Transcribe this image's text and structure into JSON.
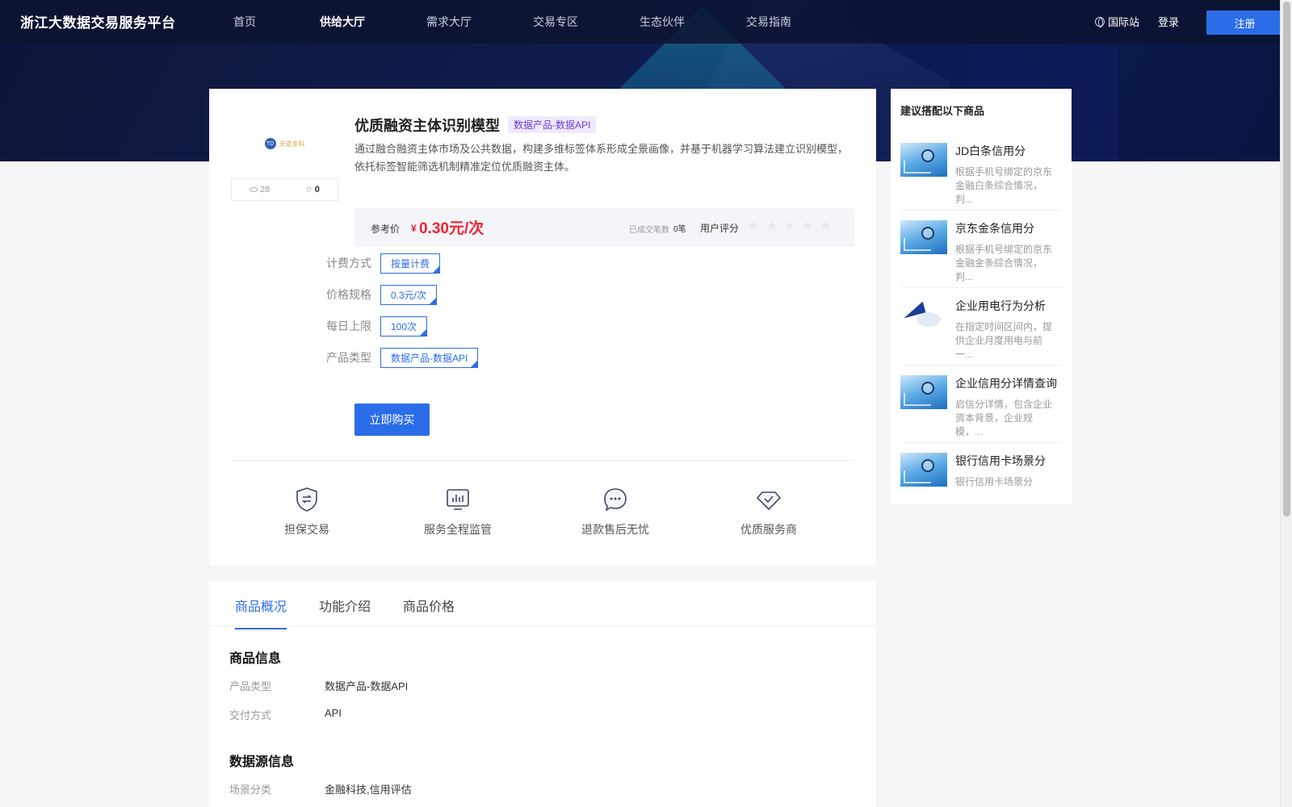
{
  "header": {
    "logo": "浙江大数据交易服务平台",
    "nav": [
      "首页",
      "供给大厅",
      "需求大厅",
      "交易专区",
      "生态伙伴",
      "交易指南"
    ],
    "active_nav": 1,
    "intl": "国际站",
    "login": "登录",
    "register": "注册"
  },
  "product": {
    "logo_brand": "天道金科",
    "logo_mark": "TD",
    "views": "28",
    "stars": "0",
    "title": "优质融资主体识别模型",
    "type_badge": "数据产品-数据API",
    "description": "通过融合融资主体市场及公共数据，构建多维标签体系形成全景画像，并基于机器学习算法建立识别模型，依托标签智能筛选机制精准定位优质融资主体。",
    "price_label": "参考价",
    "currency": "¥",
    "price": "0.30元/次",
    "deals_label": "已成交笔数",
    "deals_value": "0笔",
    "rating_label": "用户评分",
    "rating_stars": "★★★★★",
    "rating": 0,
    "specs": [
      {
        "label": "计费方式",
        "value": "按量计费"
      },
      {
        "label": "价格规格",
        "value": "0.3元/次"
      },
      {
        "label": "每日上限",
        "value": "100次"
      },
      {
        "label": "产品类型",
        "value": "数据产品-数据API"
      }
    ],
    "buy_button": "立即购买",
    "guarantees": [
      {
        "icon": "shield-exchange-icon",
        "text": "担保交易"
      },
      {
        "icon": "monitor-chart-icon",
        "text": "服务全程监管"
      },
      {
        "icon": "chat-bubble-icon",
        "text": "退款售后无忧"
      },
      {
        "icon": "diamond-check-icon",
        "text": "优质服务商"
      }
    ]
  },
  "tabs": {
    "items": [
      "商品概况",
      "功能介绍",
      "商品价格"
    ],
    "active": 0
  },
  "details": {
    "product_info_title": "商品信息",
    "product_info": [
      {
        "k": "产品类型",
        "v": "数据产品-数据API"
      },
      {
        "k": "交付方式",
        "v": "API"
      }
    ],
    "source_info_title": "数据源信息",
    "source_info": [
      {
        "k": "场景分类",
        "v": "金融科技,信用评估"
      }
    ]
  },
  "recommend": {
    "title": "建议搭配以下商品",
    "items": [
      {
        "name": "JD白条信用分",
        "desc": "根据手机号绑定的京东金融白条综合情况，判..."
      },
      {
        "name": "京东金条信用分",
        "desc": "根据手机号绑定的京东金融金条综合情况，判..."
      },
      {
        "name": "企业用电行为分析",
        "desc": "在指定时间区间内，提供企业月度用电与前一..."
      },
      {
        "name": "企业信用分详情查询",
        "desc": "启信分详情，包含企业资本背景，企业规模，..."
      },
      {
        "name": "银行信用卡场景分",
        "desc": "银行信用卡场景分"
      }
    ]
  }
}
